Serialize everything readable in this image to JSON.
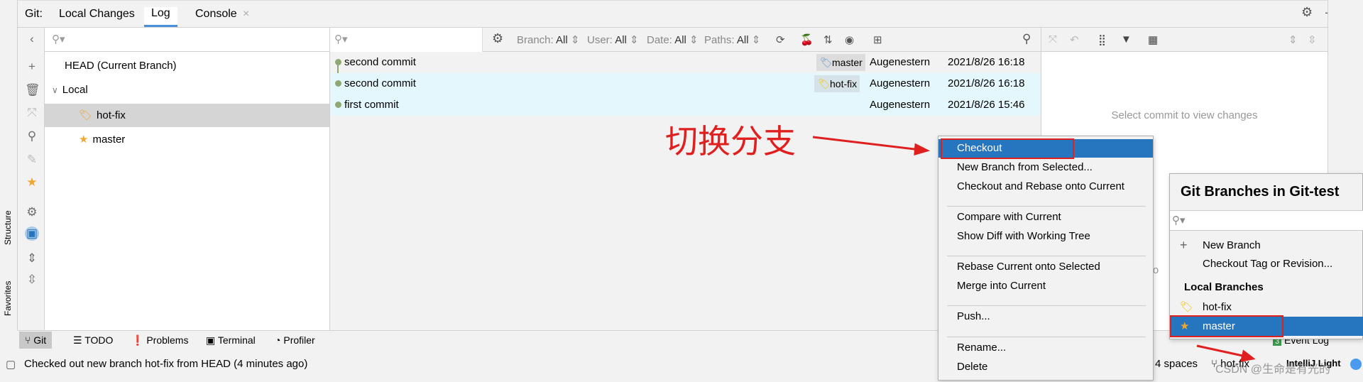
{
  "tabs": {
    "prefix": "Git:",
    "items": [
      {
        "label": "Local Changes"
      },
      {
        "label": "Log",
        "active": true
      },
      {
        "label": "Console"
      }
    ],
    "close_icon": "×"
  },
  "side_labels": {
    "structure": "Structure",
    "favorites": "Favorites"
  },
  "branches": {
    "search_placeholder": "",
    "head": "HEAD (Current Branch)",
    "local": "Local",
    "items": [
      {
        "name": "hot-fix",
        "icon": "tag-icon",
        "selected": true
      },
      {
        "name": "master",
        "icon": "star-icon"
      }
    ]
  },
  "filters": [
    {
      "label": "Branch:",
      "value": "All"
    },
    {
      "label": "User:",
      "value": "All"
    },
    {
      "label": "Date:",
      "value": "All"
    },
    {
      "label": "Paths:",
      "value": "All"
    }
  ],
  "commits": [
    {
      "message": "second commit",
      "tag": "master",
      "tag_color": "#5b9bd5",
      "author": "Augenestern",
      "date": "2021/8/26 16:18"
    },
    {
      "message": "second commit",
      "tag": "hot-fix",
      "tag_color": "#f0c419",
      "author": "Augenestern",
      "date": "2021/8/26 16:18",
      "highlight": true
    },
    {
      "message": "first commit",
      "tag": "",
      "author": "Augenestern",
      "date": "2021/8/26 15:46",
      "highlight": true
    }
  ],
  "details": {
    "empty": "Select commit to view changes",
    "partial": "Co"
  },
  "annotation": {
    "text": "切换分支",
    "color": "#e0201f"
  },
  "context_menu": {
    "items": [
      "Checkout",
      "New Branch from Selected...",
      "Checkout and Rebase onto Current",
      "Compare with Current",
      "Show Diff with Working Tree",
      "Rebase Current onto Selected",
      "Merge into Current",
      "Push...",
      "Rename...",
      "Delete"
    ],
    "selected": "Checkout",
    "accent": "#2675bf"
  },
  "branch_popup": {
    "title": "Git Branches in Git-test",
    "new_branch": "New Branch",
    "checkout_tag": "Checkout Tag or Revision...",
    "section": "Local Branches",
    "branches": [
      {
        "name": "hot-fix",
        "icon": "tag-icon"
      },
      {
        "name": "master",
        "icon": "star-icon",
        "selected": true
      }
    ]
  },
  "bottom_tools": [
    {
      "label": "Git",
      "active": true
    },
    {
      "label": "TODO"
    },
    {
      "label": "Problems"
    },
    {
      "label": "Terminal"
    },
    {
      "label": "Profiler"
    }
  ],
  "event_log": {
    "count": "3",
    "label": "Event Log"
  },
  "status": {
    "message": "Checked out new branch hot-fix from HEAD (4 minutes ago)",
    "indent": "4 spaces",
    "branch": "hot-fix",
    "theme": "IntelliJ Light"
  },
  "watermark": "CSDN @生命是有光的"
}
